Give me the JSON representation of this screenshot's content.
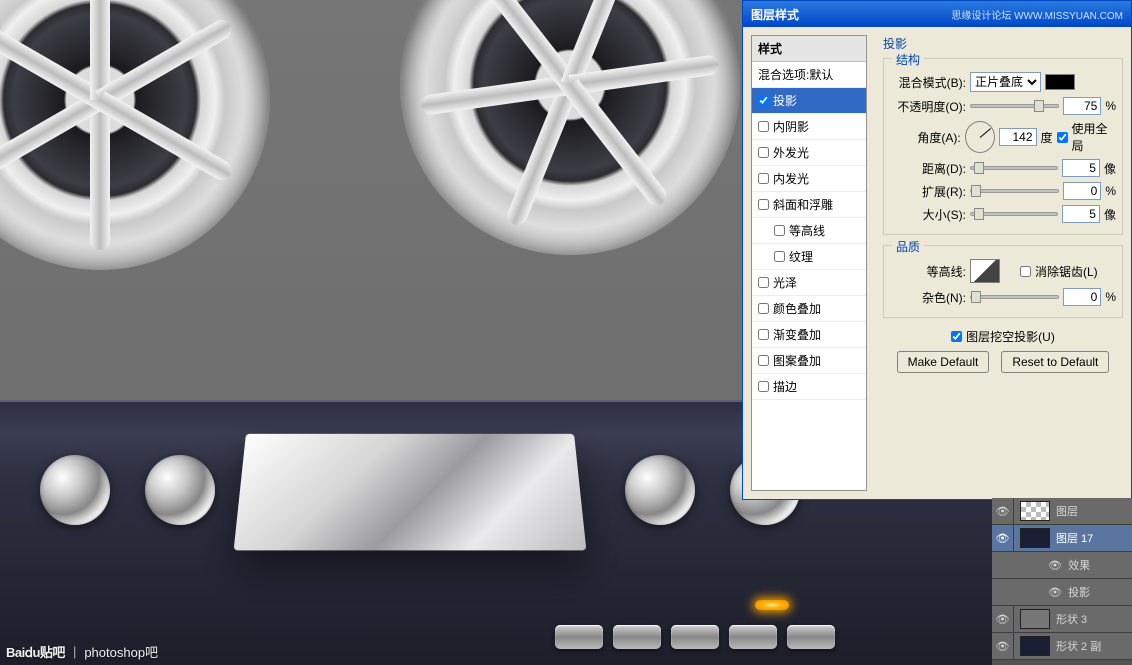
{
  "dialog": {
    "title": "图层样式",
    "brand": "思缘设计论坛  WWW.MISSYUAN.COM",
    "styles_header": "样式",
    "styles": [
      {
        "label": "混合选项:默认",
        "checked": null
      },
      {
        "label": "投影",
        "checked": true,
        "selected": true
      },
      {
        "label": "内阴影",
        "checked": false
      },
      {
        "label": "外发光",
        "checked": false
      },
      {
        "label": "内发光",
        "checked": false
      },
      {
        "label": "斜面和浮雕",
        "checked": false
      },
      {
        "label": "等高线",
        "checked": false,
        "sub": true
      },
      {
        "label": "纹理",
        "checked": false,
        "sub": true
      },
      {
        "label": "光泽",
        "checked": false
      },
      {
        "label": "颜色叠加",
        "checked": false
      },
      {
        "label": "渐变叠加",
        "checked": false
      },
      {
        "label": "图案叠加",
        "checked": false
      },
      {
        "label": "描边",
        "checked": false
      }
    ],
    "section_title": "投影",
    "structure": {
      "group_label": "结构",
      "blend_mode_label": "混合模式(B):",
      "blend_mode_value": "正片叠底",
      "opacity_label": "不透明度(O):",
      "opacity_value": "75",
      "opacity_unit": "%",
      "angle_label": "角度(A):",
      "angle_value": "142",
      "angle_unit": "度",
      "use_global_light": "使用全局",
      "distance_label": "距离(D):",
      "distance_value": "5",
      "distance_unit": "像",
      "spread_label": "扩展(R):",
      "spread_value": "0",
      "spread_unit": "%",
      "size_label": "大小(S):",
      "size_value": "5",
      "size_unit": "像"
    },
    "quality": {
      "group_label": "品质",
      "contour_label": "等高线:",
      "antialias_label": "消除锯齿(L)",
      "noise_label": "杂色(N):",
      "noise_value": "0",
      "noise_unit": "%"
    },
    "knockout_label": "图层挖空投影(U)",
    "make_default": "Make Default",
    "reset_default": "Reset to Default"
  },
  "layers": {
    "items": [
      {
        "label": "图层",
        "kind": "group",
        "chk": true
      },
      {
        "label": "图层 17",
        "selected": true
      },
      {
        "label": "效果",
        "kind": "fx"
      },
      {
        "label": "投影",
        "kind": "fx"
      },
      {
        "label": "形状 3"
      },
      {
        "label": "形状 2 副"
      }
    ]
  },
  "watermark": {
    "logo": "Bai𝖽u贴吧",
    "sep": "|",
    "name": "photoshop吧"
  }
}
